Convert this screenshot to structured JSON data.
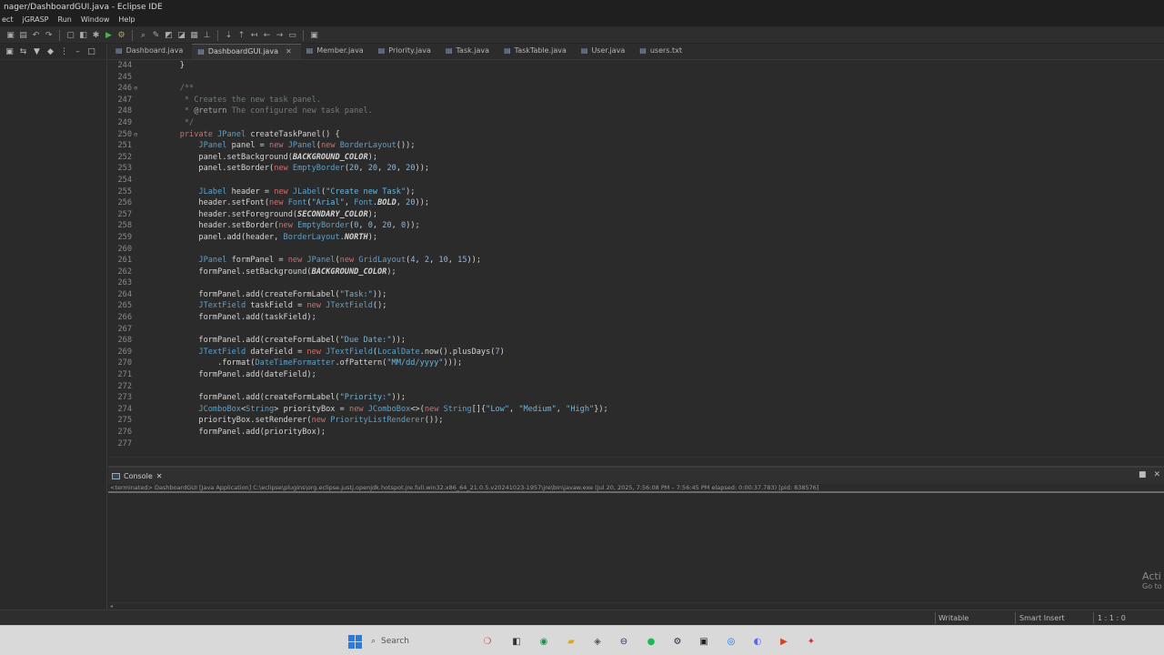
{
  "window": {
    "title": "nager/DashboardGUI.java - Eclipse IDE"
  },
  "menu": [
    "ect",
    "jGRASP",
    "Run",
    "Window",
    "Help"
  ],
  "toolbar": {
    "icons": [
      "save-icon",
      "save-all-icon",
      "undo-icon",
      "redo-icon",
      "new-icon",
      "open-type-icon",
      "debug-icon",
      "run-icon",
      "external-tools-icon",
      "search-icon",
      "pencil-icon",
      "navigate-back-icon",
      "navigate-forward-icon"
    ]
  },
  "editor": {
    "tabs": [
      {
        "label": "Dashboard.java",
        "active": false
      },
      {
        "label": "DashboardGUI.java",
        "active": true
      },
      {
        "label": "Member.java",
        "active": false
      },
      {
        "label": "Priority.java",
        "active": false
      },
      {
        "label": "Task.java",
        "active": false
      },
      {
        "label": "TaskTable.java",
        "active": false
      },
      {
        "label": "User.java",
        "active": false
      },
      {
        "label": "users.txt",
        "active": false
      }
    ],
    "lines": [
      {
        "n": "244",
        "marker": "",
        "code": "    }"
      },
      {
        "n": "245",
        "marker": "",
        "code": ""
      },
      {
        "n": "246",
        "marker": "⊖",
        "code": "    /**"
      },
      {
        "n": "247",
        "marker": "",
        "code": "     * Creates the new task panel."
      },
      {
        "n": "248",
        "marker": "",
        "code": "     * @return The configured new task panel."
      },
      {
        "n": "249",
        "marker": "",
        "code": "     */"
      },
      {
        "n": "250",
        "marker": "⊖",
        "code": "    private JPanel createTaskPanel() {"
      },
      {
        "n": "251",
        "marker": "",
        "code": "        JPanel panel = new JPanel(new BorderLayout());"
      },
      {
        "n": "252",
        "marker": "",
        "code": "        panel.setBackground(BACKGROUND_COLOR);"
      },
      {
        "n": "253",
        "marker": "",
        "code": "        panel.setBorder(new EmptyBorder(20, 20, 20, 20));"
      },
      {
        "n": "254",
        "marker": "",
        "code": ""
      },
      {
        "n": "255",
        "marker": "",
        "code": "        JLabel header = new JLabel(\"Create new Task\");"
      },
      {
        "n": "256",
        "marker": "",
        "code": "        header.setFont(new Font(\"Arial\", Font.BOLD, 20));"
      },
      {
        "n": "257",
        "marker": "",
        "code": "        header.setForeground(SECONDARY_COLOR);"
      },
      {
        "n": "258",
        "marker": "",
        "code": "        header.setBorder(new EmptyBorder(0, 0, 20, 0));"
      },
      {
        "n": "259",
        "marker": "",
        "code": "        panel.add(header, BorderLayout.NORTH);"
      },
      {
        "n": "260",
        "marker": "",
        "code": ""
      },
      {
        "n": "261",
        "marker": "",
        "code": "        JPanel formPanel = new JPanel(new GridLayout(4, 2, 10, 15));"
      },
      {
        "n": "262",
        "marker": "",
        "code": "        formPanel.setBackground(BACKGROUND_COLOR);"
      },
      {
        "n": "263",
        "marker": "",
        "code": ""
      },
      {
        "n": "264",
        "marker": "",
        "code": "        formPanel.add(createFormLabel(\"Task:\"));"
      },
      {
        "n": "265",
        "marker": "",
        "code": "        JTextField taskField = new JTextField();"
      },
      {
        "n": "266",
        "marker": "",
        "code": "        formPanel.add(taskField);"
      },
      {
        "n": "267",
        "marker": "",
        "code": ""
      },
      {
        "n": "268",
        "marker": "",
        "code": "        formPanel.add(createFormLabel(\"Due Date:\"));"
      },
      {
        "n": "269",
        "marker": "",
        "code": "        JTextField dateField = new JTextField(LocalDate.now().plusDays(7)"
      },
      {
        "n": "270",
        "marker": "",
        "code": "            .format(DateTimeFormatter.ofPattern(\"MM/dd/yyyy\")));"
      },
      {
        "n": "271",
        "marker": "",
        "code": "        formPanel.add(dateField);"
      },
      {
        "n": "272",
        "marker": "",
        "code": ""
      },
      {
        "n": "273",
        "marker": "",
        "code": "        formPanel.add(createFormLabel(\"Priority:\"));"
      },
      {
        "n": "274",
        "marker": "",
        "code": "        JComboBox<String> priorityBox = new JComboBox<>(new String[]{\"Low\", \"Medium\", \"High\"});"
      },
      {
        "n": "275",
        "marker": "",
        "code": "        priorityBox.setRenderer(new PriorityListRenderer());"
      },
      {
        "n": "276",
        "marker": "",
        "code": "        formPanel.add(priorityBox);"
      },
      {
        "n": "277",
        "marker": "",
        "code": ""
      }
    ]
  },
  "console": {
    "tab_label": "Console",
    "status": "<terminated> DashboardGUI [Java Application] C:\\eclipse\\plugins\\org.eclipse.justj.openjdk.hotspot.jre.full.win32.x86_64_21.0.5.v20241023-1957\\jre\\bin\\javaw.exe (Jul 20, 2025, 7:56:08 PM – 7:56:45 PM elapsed: 0:00:37.783) [pid: 838576]"
  },
  "watermark": {
    "line1": "Acti",
    "line2": "Go to"
  },
  "statusbar": {
    "writable": "Writable",
    "insert_mode": "Smart Insert",
    "position": "1 : 1 : 0"
  },
  "taskbar": {
    "search_placeholder": "Search"
  },
  "colors": {
    "keyword": "#cc6f6f",
    "type": "#5ea0c8",
    "string": "#6fb4d8",
    "comment": "#6e7f6e",
    "background": "#2b2b2b",
    "taskbar": "#d9d9d9"
  }
}
